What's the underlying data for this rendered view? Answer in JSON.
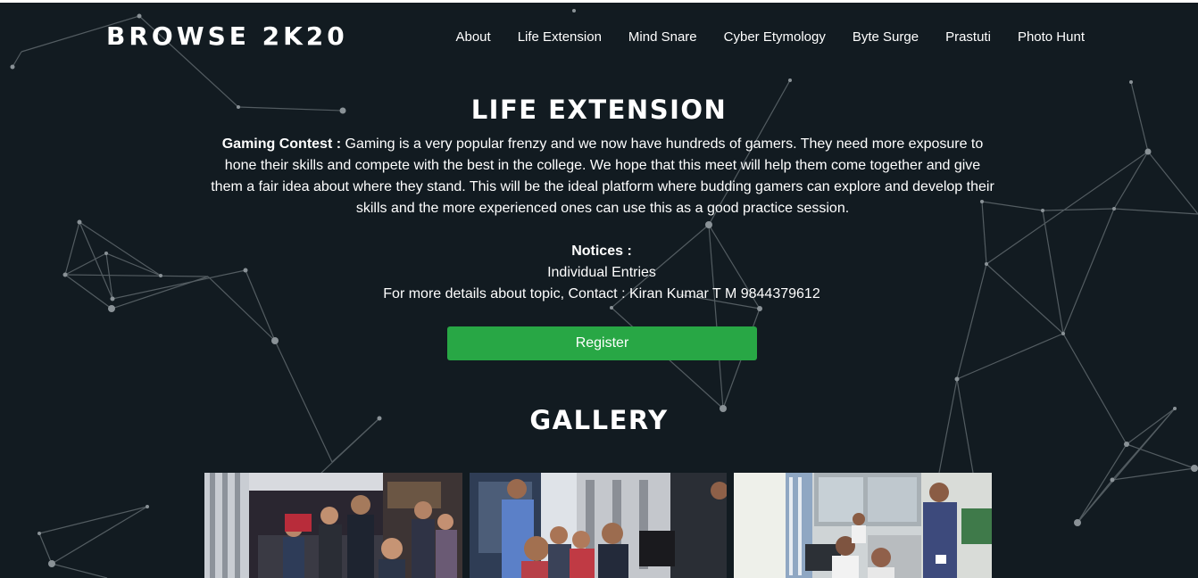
{
  "brand": "BROWSE 2K20",
  "nav": [
    "About",
    "Life Extension",
    "Mind Snare",
    "Cyber Etymology",
    "Byte Surge",
    "Prastuti",
    "Photo Hunt"
  ],
  "event": {
    "title": "LIFE EXTENSION",
    "desc_label": "Gaming Contest :",
    "desc_text": " Gaming is a very popular frenzy and we now have hundreds of gamers. They need more exposure to hone their skills and compete with the best in the college. We hope that this meet will help them come together and give them a fair idea about where they stand. This will be the ideal platform where budding gamers can explore and develop their skills and the more experienced ones can use this as a good practice session.",
    "notices_label": "Notices :",
    "notice_1": "Individual Entries",
    "notice_2": "For more details about topic, Contact : Kiran Kumar T M 9844379612",
    "register_label": "Register"
  },
  "gallery": {
    "title": "GALLERY"
  },
  "colors": {
    "background": "#121b21",
    "register": "#28a745",
    "network_lines": "#6b7378"
  }
}
